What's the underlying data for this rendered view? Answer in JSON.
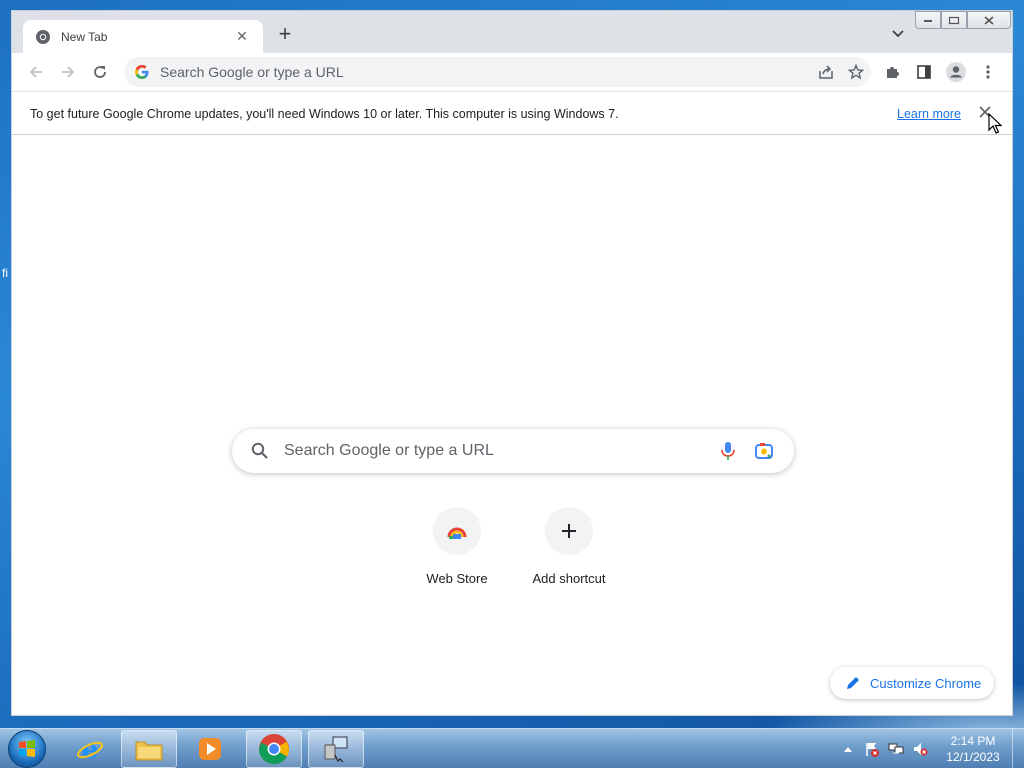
{
  "desktop": {
    "fragment_text": "fi"
  },
  "browser": {
    "tab": {
      "title": "New Tab",
      "favicon": "chrome-icon"
    },
    "new_tab_symbol": "+",
    "tab_search_icon": "chevron-down-icon",
    "caption": {
      "minimize": "minimize-icon",
      "maximize": "restore-icon",
      "close": "close-icon"
    },
    "toolbar": {
      "back": "back-arrow-icon",
      "forward": "forward-arrow-icon",
      "reload": "reload-icon",
      "omnibox_placeholder": "Search Google or type a URL",
      "share": "share-icon",
      "bookmark": "star-icon",
      "extensions": "puzzle-icon",
      "side_panel": "side-panel-icon",
      "profile": "profile-icon",
      "menu": "kebab-menu-icon"
    },
    "infobar": {
      "message": "To get future Google Chrome updates, you'll need Windows 10 or later. This computer is using Windows 7.",
      "link": "Learn more"
    },
    "ntp": {
      "search_placeholder": "Search Google or type a URL",
      "shortcuts": [
        {
          "label": "Web Store",
          "icon": "web-store-icon"
        },
        {
          "label": "Add shortcut",
          "icon": "plus-icon"
        }
      ],
      "customize_label": "Customize Chrome"
    }
  },
  "taskbar": {
    "pinned": [
      "internet-explorer-icon",
      "file-explorer-icon",
      "media-player-icon",
      "chrome-icon",
      "remote-desktop-icon"
    ],
    "active_item": "chrome-icon",
    "clock": {
      "time": "2:14 PM",
      "date": "12/1/2023"
    }
  },
  "colors": {
    "accent_blue": "#1a73e8",
    "tab_strip": "#dee1e6",
    "omnibox_bg": "#f1f3f4"
  }
}
